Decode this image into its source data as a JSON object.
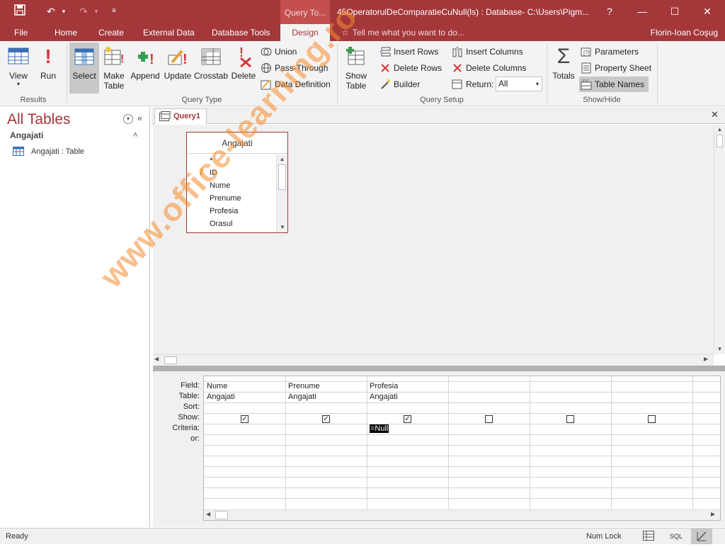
{
  "titlebar": {
    "context_tab": "Query To...",
    "doc_title": "45OperatorulDeComparatieCuNull(ls) : Database- C:\\Users\\Pigm...",
    "help": "?"
  },
  "ribbon_tabs": [
    "File",
    "Home",
    "Create",
    "External Data",
    "Database Tools",
    "Design"
  ],
  "tell_me": "Tell me what you want to do...",
  "user_name": "Florin-Ioan Coşug",
  "groups": {
    "results": "Results",
    "query_type": "Query Type",
    "query_setup": "Query Setup",
    "show_hide": "Show/Hide"
  },
  "buttons": {
    "view": "View",
    "run": "Run",
    "select": "Select",
    "make_table_1": "Make",
    "make_table_2": "Table",
    "append": "Append",
    "update": "Update",
    "crosstab": "Crosstab",
    "delete": "Delete",
    "union": "Union",
    "pass_through": "Pass-Through",
    "data_definition": "Data Definition",
    "show_table_1": "Show",
    "show_table_2": "Table",
    "insert_rows": "Insert Rows",
    "delete_rows": "Delete Rows",
    "builder": "Builder",
    "insert_columns": "Insert Columns",
    "delete_columns": "Delete Columns",
    "return_label": "Return:",
    "return_value": "All",
    "totals": "Totals",
    "parameters": "Parameters",
    "property_sheet": "Property Sheet",
    "table_names": "Table Names"
  },
  "nav": {
    "title": "All Tables",
    "group": "Angajati",
    "item": "Angajati : Table"
  },
  "doc_tab": "Query1",
  "table_box": {
    "title": "Angajati",
    "fields": [
      "*",
      "ID",
      "Nume",
      "Prenume",
      "Profesia",
      "Orasul"
    ]
  },
  "grid": {
    "row_labels": [
      "Field:",
      "Table:",
      "Sort:",
      "Show:",
      "Criteria:",
      "or:"
    ],
    "columns": [
      {
        "field": "Nume",
        "table": "Angajati",
        "show": true,
        "criteria": ""
      },
      {
        "field": "Prenume",
        "table": "Angajati",
        "show": true,
        "criteria": ""
      },
      {
        "field": "Profesia",
        "table": "Angajati",
        "show": true,
        "criteria": "=Null"
      },
      {
        "field": "",
        "table": "",
        "show": false,
        "criteria": ""
      },
      {
        "field": "",
        "table": "",
        "show": false,
        "criteria": ""
      },
      {
        "field": "",
        "table": "",
        "show": false,
        "criteria": ""
      }
    ]
  },
  "status": {
    "left": "Ready",
    "num_lock": "Num Lock",
    "sql": "SQL"
  },
  "watermark": "www.office-learning.ro",
  "colors": {
    "accent": "#a4373a",
    "watermark": "#f58c2d"
  }
}
